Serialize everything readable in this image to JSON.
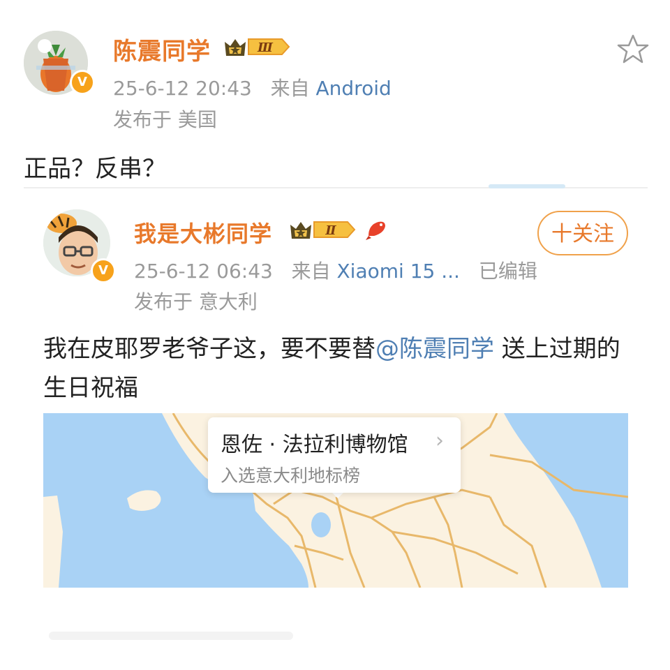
{
  "post": {
    "author": {
      "name": "陈震同学",
      "avatar_icon": "carrot-sticker-avatar",
      "verified_badge": "V",
      "level_badge": "Ⅲ"
    },
    "time": "25-6-12 20:43",
    "source_prefix": "来自",
    "source": "Android",
    "location": "发布于 美国",
    "content": "正品？反串？"
  },
  "repost": {
    "author": {
      "name": "我是大彬同学",
      "avatar_icon": "tiger-memoji-avatar",
      "verified_badge": "V",
      "level_badge": "Ⅱ",
      "extra_badge_icon": "koi-icon"
    },
    "follow_label": "十关注",
    "time": "25-6-12 06:43",
    "source_prefix": "来自",
    "source": "Xiaomi 15 ...",
    "edited": "已编辑",
    "location": "发布于 意大利",
    "content_before": "我在皮耶罗老爷子这，要不要替",
    "mention": "@陈震同学",
    "content_after": " 送上过期的生日祝福",
    "map": {
      "poi_title": "恩佐 · 法拉利博物馆",
      "poi_subtitle": "入选意大利地标榜",
      "water_color": "#a9d2f5",
      "land_color": "#fbf2e1",
      "border_color": "#e8b86a"
    }
  },
  "colors": {
    "name": "#e8792b",
    "link": "#4f7fb3",
    "meta": "#9a9a9a",
    "verified": "#f7a21b"
  }
}
